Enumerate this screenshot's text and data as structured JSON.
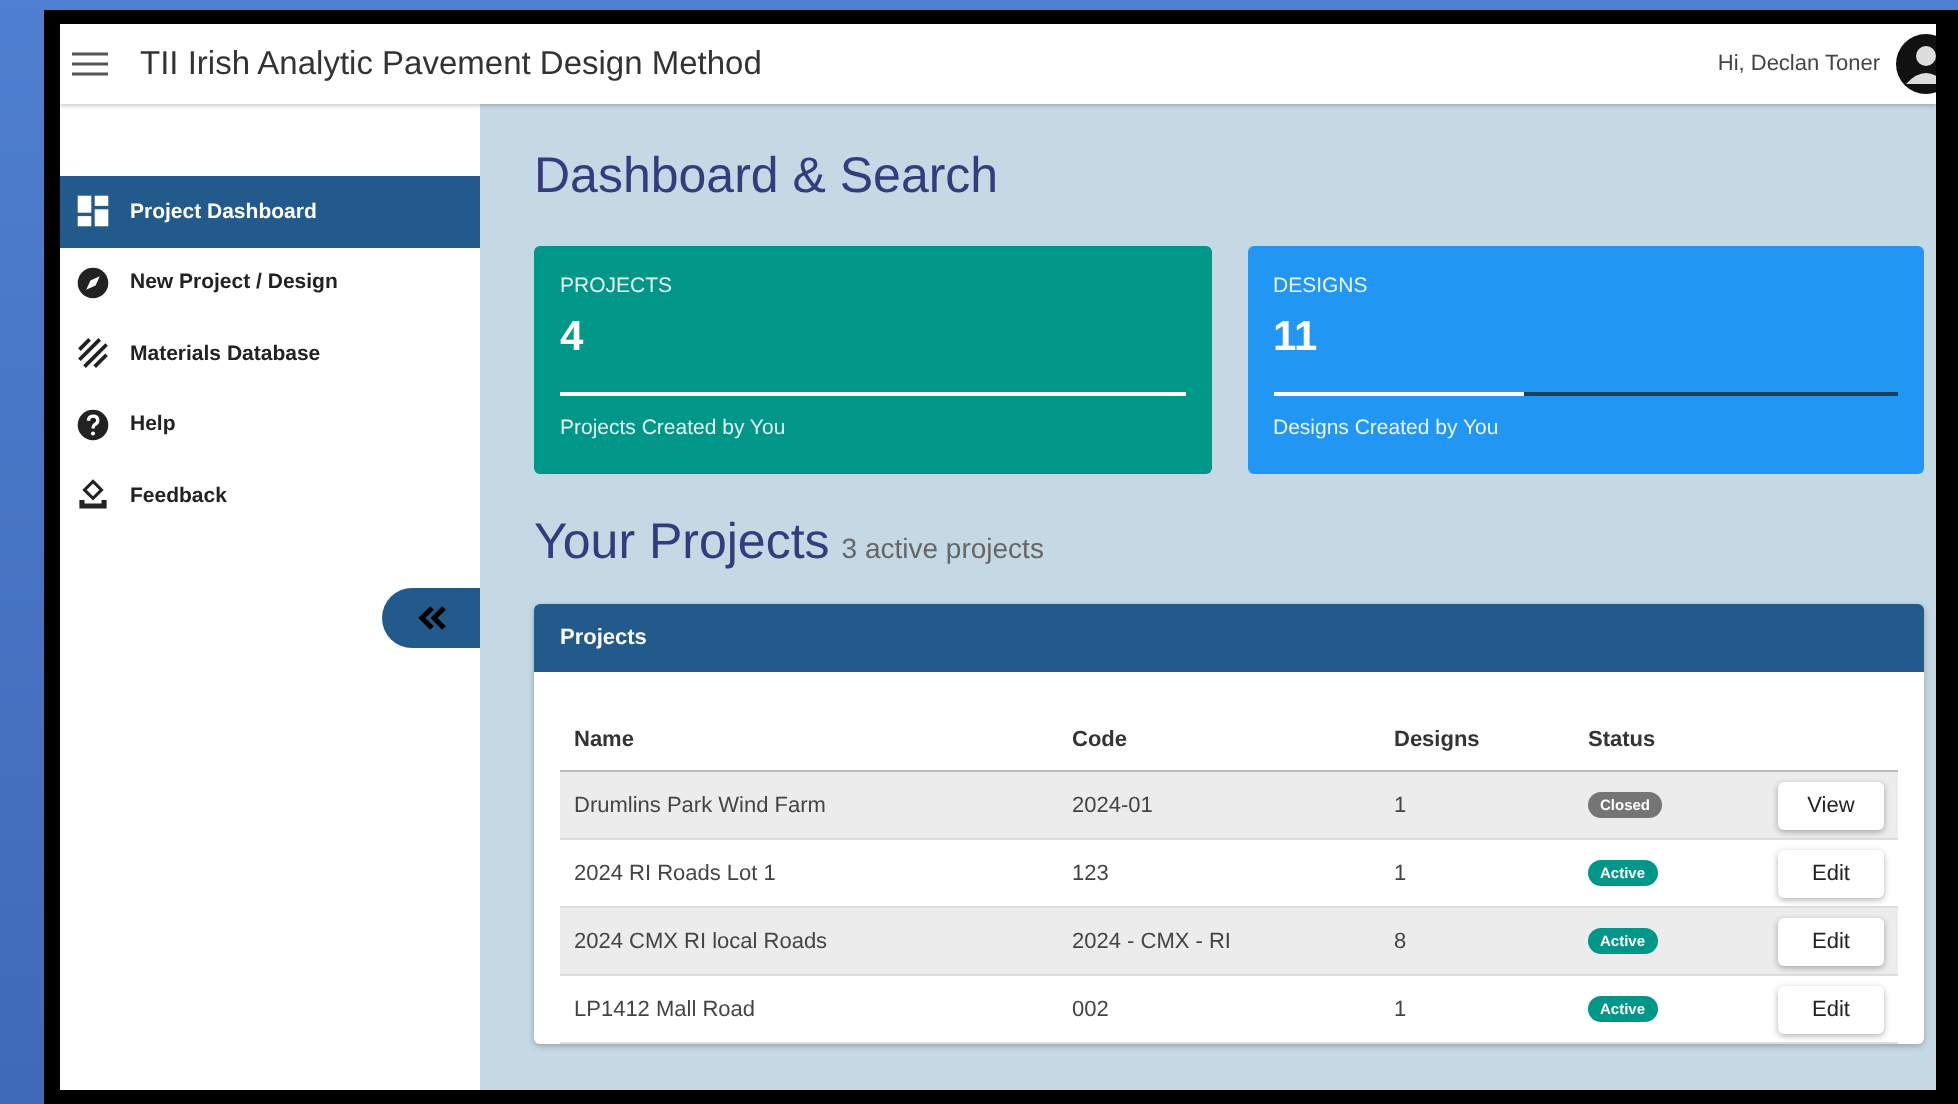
{
  "header": {
    "title": "TII Irish Analytic Pavement Design Method",
    "greeting": "Hi, Declan Toner"
  },
  "sidebar": {
    "items": [
      {
        "label": "Project Dashboard",
        "selected": true
      },
      {
        "label": "New Project / Design",
        "selected": false
      },
      {
        "label": "Materials Database",
        "selected": false
      },
      {
        "label": "Help",
        "selected": false
      },
      {
        "label": "Feedback",
        "selected": false
      }
    ]
  },
  "page_title": "Dashboard & Search",
  "stats": [
    {
      "label": "PROJECTS",
      "value": "4",
      "level": 1.0,
      "caption": "Projects Created by You",
      "color": "#009688"
    },
    {
      "label": "DESIGNS",
      "value": "11",
      "level": 0.4,
      "caption": "Designs Created by You",
      "color": "#2196f3"
    }
  ],
  "projects_heading": {
    "title": "Your Projects",
    "subtitle": "3 active projects"
  },
  "table": {
    "title": "Projects",
    "columns": [
      "Name",
      "Code",
      "Designs",
      "Status"
    ],
    "rows": [
      {
        "name": "Drumlins Park Wind Farm",
        "code": "2024-01",
        "designs": "1",
        "status": "Closed",
        "color": "#757575",
        "action": "View"
      },
      {
        "name": "2024 RI Roads Lot 1",
        "code": "123",
        "designs": "1",
        "status": "Active",
        "color": "#009688",
        "action": "Edit"
      },
      {
        "name": "2024 CMX RI local Roads",
        "code": "2024 - CMX - RI",
        "designs": "8",
        "status": "Active",
        "color": "#009688",
        "action": "Edit"
      },
      {
        "name": "LP1412 Mall Road",
        "code": "002",
        "designs": "1",
        "status": "Active",
        "color": "#009688",
        "action": "Edit"
      }
    ]
  }
}
